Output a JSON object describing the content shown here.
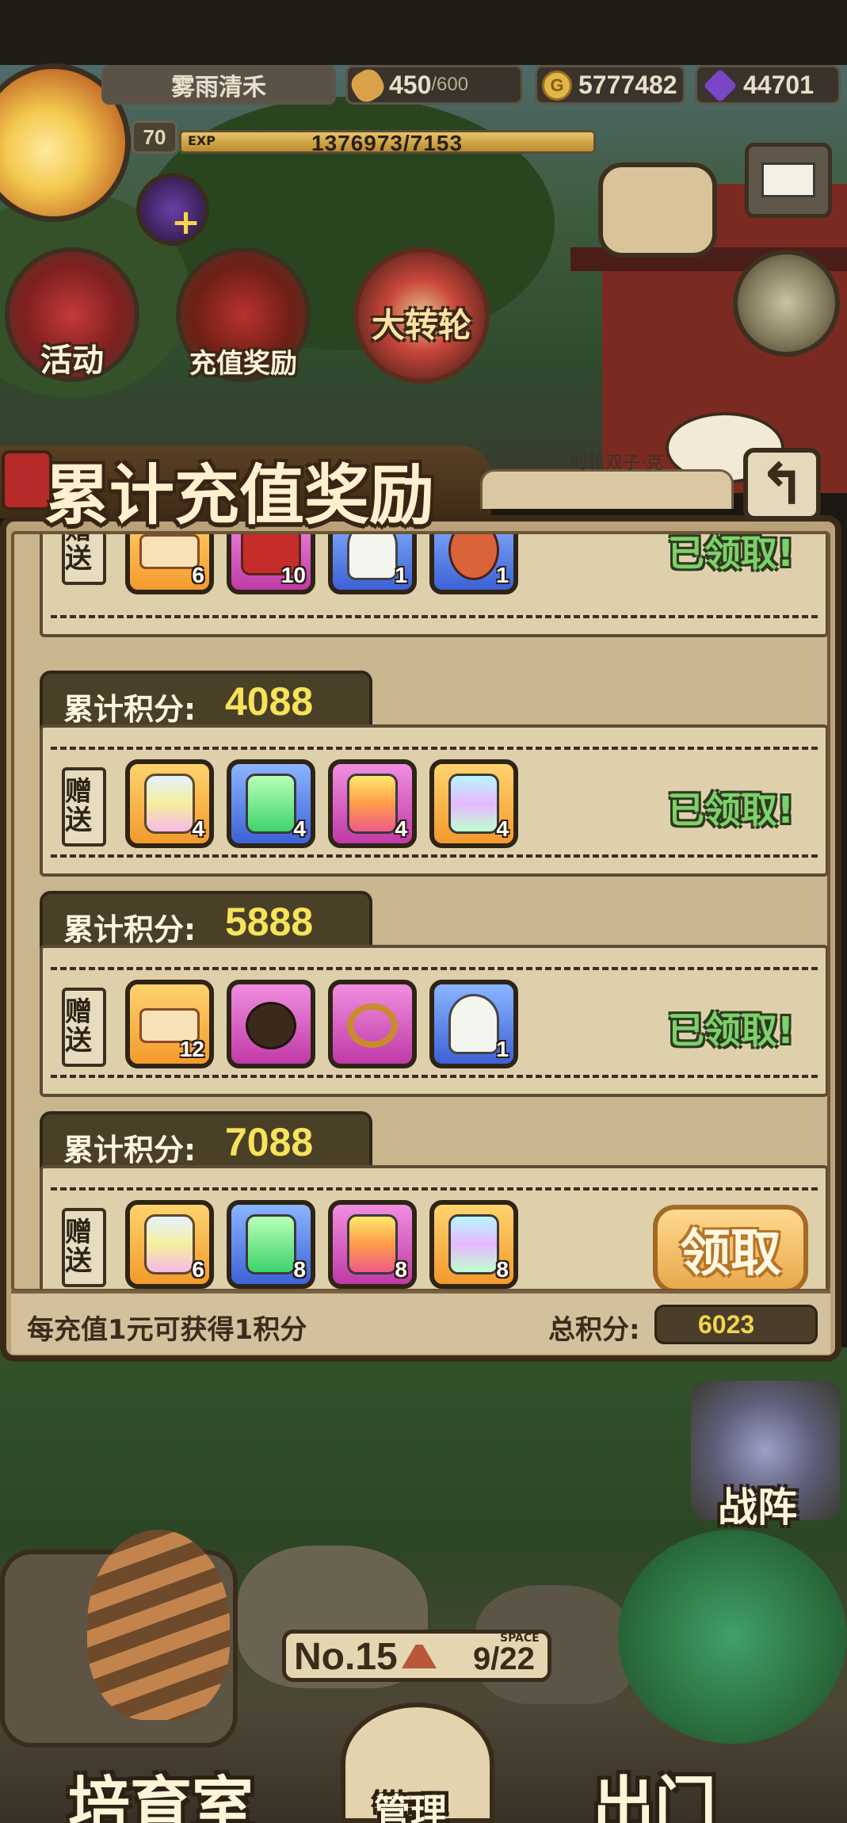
{
  "player": {
    "name": "雾雨清禾",
    "level": "70",
    "exp_label": "EXP",
    "exp_text": "1376973/7153"
  },
  "currencies": {
    "food_current": "450",
    "food_max": "/600",
    "gold": "5777482",
    "gems": "44701",
    "gold_symbol": "G"
  },
  "hud_buttons": {
    "activity": "活动",
    "recharge_reward": "充值奖励",
    "wheel": "大转轮",
    "gem_plus": "+"
  },
  "modal": {
    "title": "累计充值奖励",
    "subtitle": "时轮双子·克",
    "back_symbol": "↰",
    "gift_tag": "赠送",
    "claimed_text": "已领取!",
    "claim_label": "领取",
    "score_label": "累计积分:",
    "footer_note": "每充值1元可获得1积分",
    "total_label": "总积分:",
    "total_value": "6023",
    "tiers": [
      {
        "score": "",
        "status": "claimed",
        "items": [
          {
            "icon": "ticket-icon",
            "frame": "orange",
            "qty": "6"
          },
          {
            "icon": "chest-icon",
            "frame": "pink",
            "qty": "10"
          },
          {
            "icon": "ghost-orb-icon",
            "frame": "blue",
            "qty": "1"
          },
          {
            "icon": "hero-portrait-icon",
            "frame": "blue",
            "qty": "1"
          }
        ]
      },
      {
        "score": "4088",
        "status": "claimed",
        "items": [
          {
            "icon": "winged-lantern-icon",
            "frame": "orange",
            "qty": "4"
          },
          {
            "icon": "green-jar-icon",
            "frame": "blue",
            "qty": "4"
          },
          {
            "icon": "rainbow-jar-icon",
            "frame": "pink",
            "qty": "4"
          },
          {
            "icon": "holo-jar-icon",
            "frame": "orange",
            "qty": "4"
          }
        ]
      },
      {
        "score": "5888",
        "status": "claimed",
        "items": [
          {
            "icon": "ticket-icon",
            "frame": "orange",
            "qty": "12"
          },
          {
            "icon": "belt-icon",
            "frame": "pink",
            "qty": ""
          },
          {
            "icon": "necklace-icon",
            "frame": "pink",
            "qty": ""
          },
          {
            "icon": "ghost-orb-icon",
            "frame": "blue",
            "qty": "1"
          }
        ]
      },
      {
        "score": "7088",
        "status": "claimable",
        "items": [
          {
            "icon": "winged-lantern-icon",
            "frame": "orange",
            "qty": "6"
          },
          {
            "icon": "green-jar-icon",
            "frame": "blue",
            "qty": "8"
          },
          {
            "icon": "rainbow-jar-icon",
            "frame": "pink",
            "qty": "8"
          },
          {
            "icon": "holo-jar-icon",
            "frame": "orange",
            "qty": "8"
          }
        ]
      }
    ]
  },
  "bottom_hud": {
    "formation": "战阵",
    "stage_no": "No.15",
    "space_label": "SPACE",
    "space_value": "9/22",
    "nursery": "培育室",
    "manage": "管理",
    "go_out": "出门"
  },
  "colors": {
    "claimed_green": "#7ed06c",
    "score_yellow": "#f6e35a",
    "total_yellow": "#f2d54a",
    "frame_orange": "#f39a2c",
    "frame_pink": "#c03aa6",
    "frame_blue": "#3c62d6"
  }
}
